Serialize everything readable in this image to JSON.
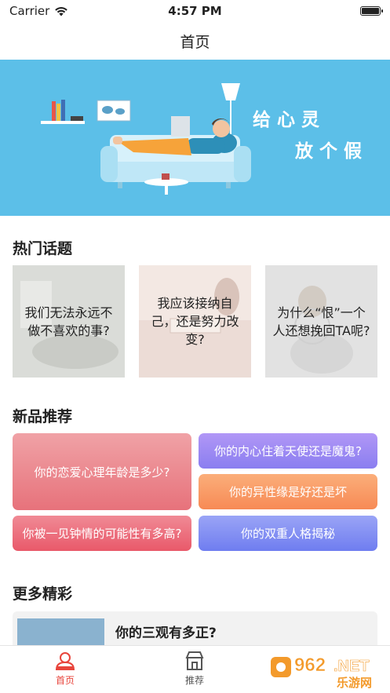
{
  "status_bar": {
    "carrier": "Carrier",
    "time": "4:57 PM"
  },
  "nav": {
    "title": "首页"
  },
  "banner": {
    "slogan_line1": "给心灵",
    "slogan_line2": "放个假"
  },
  "hot_topics": {
    "title": "热门话题",
    "items": [
      {
        "text": "我们无法永远不做不喜欢的事?"
      },
      {
        "text": "我应该接纳自己，还是努力改变?"
      },
      {
        "text": "为什么“恨”一个人还想挽回TA呢?"
      }
    ]
  },
  "new_products": {
    "title": "新品推荐",
    "items": [
      {
        "text": "你的恋爱心理年龄是多少?",
        "color": "#ec8a90"
      },
      {
        "text": "你的内心住着天使还是魔鬼?",
        "color": "#9a88f2"
      },
      {
        "text": "你的异性缘是好还是坏",
        "color": "#f9a068"
      },
      {
        "text": "你被一见钟情的可能性有多高?",
        "color": "#ee6f7b"
      },
      {
        "text": "你的双重人格揭秘",
        "color": "#7f8bf0"
      }
    ]
  },
  "more": {
    "title": "更多精彩",
    "card_title": "你的三观有多正?"
  },
  "tab_bar": {
    "items": [
      {
        "label": "首页",
        "icon": "person-badge-icon",
        "active": true
      },
      {
        "label": "推荐",
        "icon": "store-icon",
        "active": false
      }
    ]
  },
  "watermark": {
    "brand": "962.NET",
    "subtitle": "乐游网"
  },
  "colors": {
    "accent": "#e8453c",
    "banner_bg": "#5cbfe8"
  }
}
